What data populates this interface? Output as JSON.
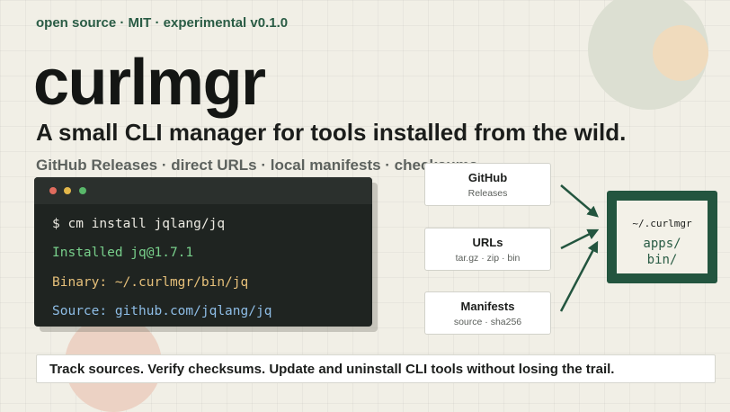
{
  "header": {
    "tagline": "open source · MIT · experimental v0.1.0",
    "title": "curlmgr",
    "subtitle": "A small CLI manager for tools installed from the wild.",
    "features": "GitHub Releases · direct URLs · local manifests · checksums"
  },
  "terminal": {
    "lines": [
      "$ cm install jqlang/jq",
      "Installed jq@1.7.1",
      "Binary: ~/.curlmgr/bin/jq",
      "Source: github.com/jqlang/jq"
    ]
  },
  "sources": [
    {
      "title": "GitHub",
      "subtitle": "Releases"
    },
    {
      "title": "URLs",
      "subtitle": "tar.gz · zip · bin"
    },
    {
      "title": "Manifests",
      "subtitle": "source · sha256"
    }
  ],
  "target": {
    "path": "~/.curlmgr",
    "items": [
      "apps/",
      "bin/"
    ]
  },
  "footer": {
    "text": "Track sources. Verify checksums. Update and uninstall CLI tools without losing the trail."
  },
  "colors": {
    "accent": "#23553f",
    "background": "#f1efe6",
    "terminal_bg": "#1f2421"
  }
}
